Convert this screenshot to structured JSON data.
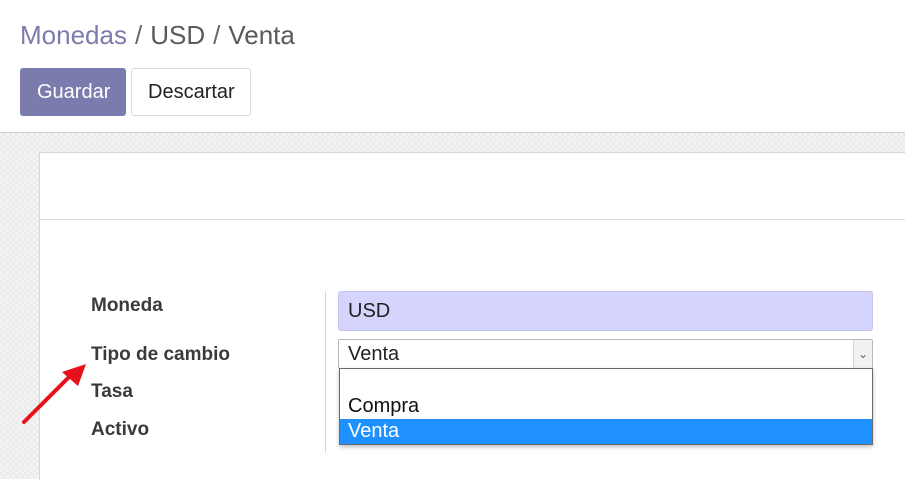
{
  "breadcrumb": {
    "items": [
      "Monedas",
      "USD",
      "Venta"
    ],
    "separator": "/"
  },
  "toolbar": {
    "save_label": "Guardar",
    "discard_label": "Descartar"
  },
  "form": {
    "labels": {
      "currency": "Moneda",
      "rate_type": "Tipo de cambio",
      "rate": "Tasa",
      "active": "Activo"
    },
    "currency_value": "USD",
    "rate_type_value": "Venta",
    "rate_type_options": [
      "",
      "Compra",
      "Venta"
    ],
    "rate_type_selected_option": "Venta"
  },
  "icons": {
    "select_arrow": "chevron-down-icon",
    "annotation": "red-arrow-icon"
  },
  "colors": {
    "primary": "#7c7bad",
    "input_highlight": "#d4d4fc",
    "option_selected": "#1e90ff",
    "annotation_arrow": "#e8101a"
  }
}
